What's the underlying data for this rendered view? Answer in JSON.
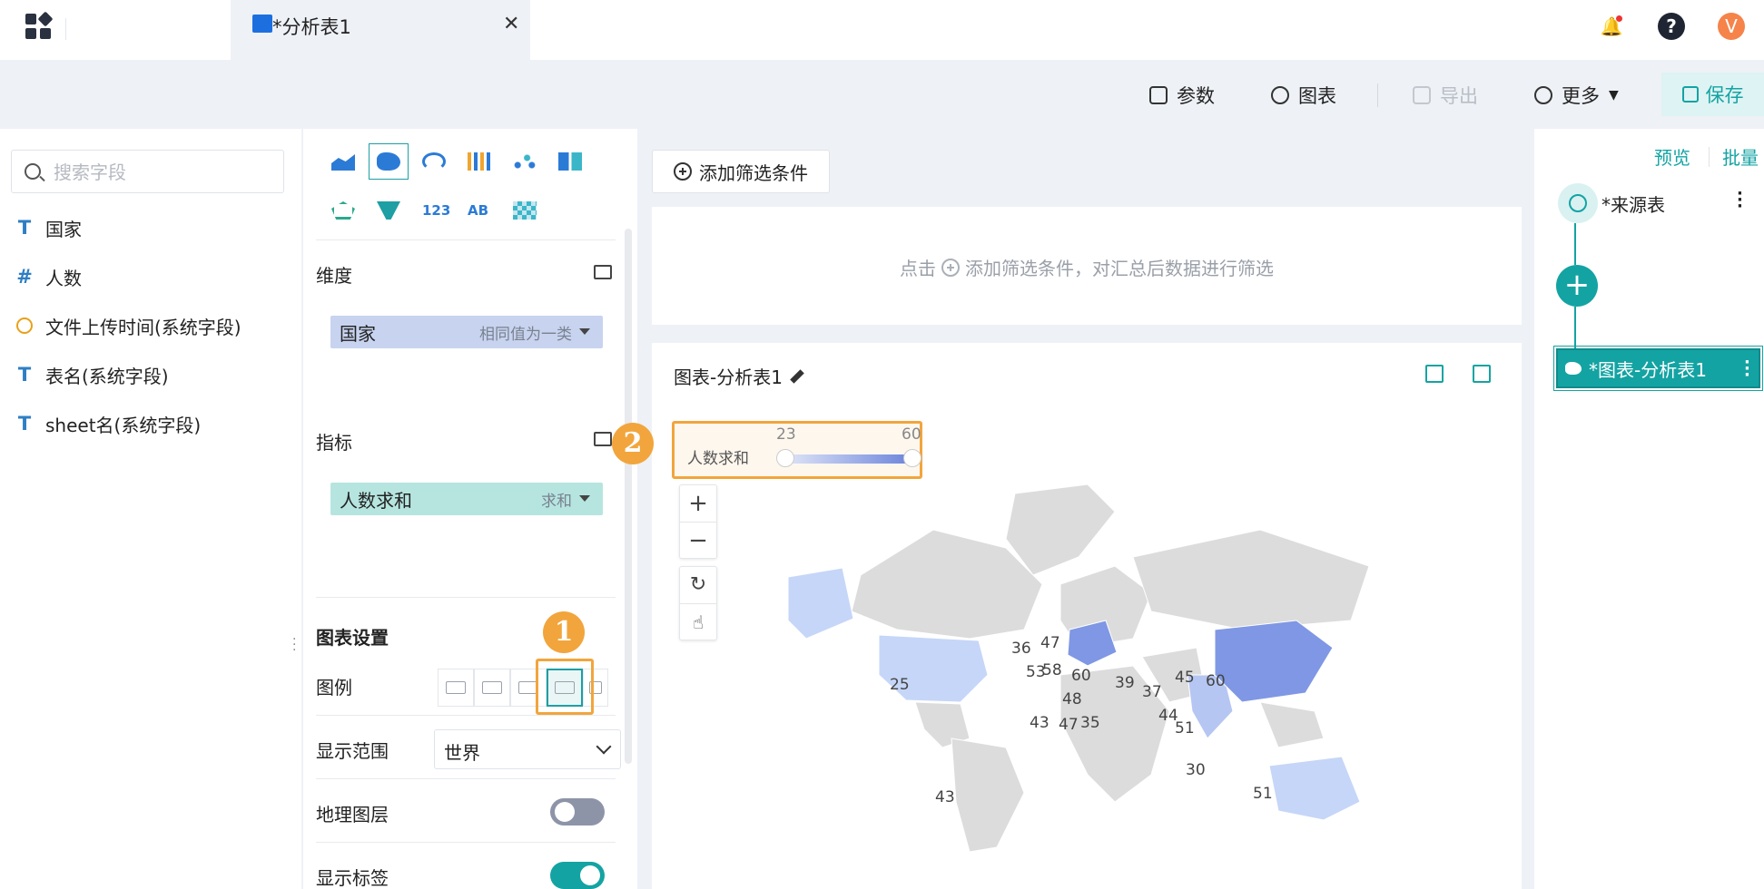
{
  "tab": {
    "title": "*分析表1",
    "close": "✕"
  },
  "user": {
    "avatar_letter": "V"
  },
  "toolbar": {
    "params": "参数",
    "chart": "图表",
    "export": "导出",
    "more": "更多",
    "save": "保存"
  },
  "fields": {
    "search_placeholder": "搜索字段",
    "items": [
      {
        "icon": "T",
        "label": "国家"
      },
      {
        "icon": "#",
        "label": "人数"
      },
      {
        "icon": "clock",
        "label": "文件上传时间(系统字段)"
      },
      {
        "icon": "T",
        "label": "表名(系统字段)"
      },
      {
        "icon": "T",
        "label": "sheet名(系统字段)"
      }
    ]
  },
  "config": {
    "dimension_title": "维度",
    "dimension_pill": {
      "label": "国家",
      "agg": "相同值为一类"
    },
    "metric_title": "指标",
    "metric_pill": {
      "label": "人数求和",
      "agg": "求和"
    },
    "chart_settings_title": "图表设置",
    "legend_label": "图例",
    "range_label": "显示范围",
    "range_value": "世界",
    "geo_layer_label": "地理图层",
    "show_labels_label": "显示标签",
    "marker_1": "1",
    "marker_2": "2"
  },
  "main": {
    "add_filter": "添加筛选条件",
    "filter_hint_pre": "点击",
    "filter_hint_post": "添加筛选条件，对汇总后数据进行筛选",
    "chart_title": "图表-分析表1",
    "visual_map": {
      "label": "人数求和",
      "min": "23",
      "max": "60"
    },
    "map_labels": [
      {
        "label": "25"
      },
      {
        "label": "36"
      },
      {
        "label": "47"
      },
      {
        "label": "53"
      },
      {
        "label": "58"
      },
      {
        "label": "60"
      },
      {
        "label": "48"
      },
      {
        "label": "43"
      },
      {
        "label": "47"
      },
      {
        "label": "35"
      },
      {
        "label": "39"
      },
      {
        "label": "37"
      },
      {
        "label": "45"
      },
      {
        "label": "60"
      },
      {
        "label": "44"
      },
      {
        "label": "51"
      },
      {
        "label": "30"
      },
      {
        "label": "51"
      },
      {
        "label": "43"
      }
    ]
  },
  "flow": {
    "preview": "预览",
    "batch": "批量",
    "source": "*来源表",
    "chart_node": "*图表-分析表1"
  },
  "colors": {
    "accent": "#14a3a3",
    "highlight": "#f2a53c",
    "dimension": "#c7d3ef",
    "metric": "#b6e5e0"
  }
}
